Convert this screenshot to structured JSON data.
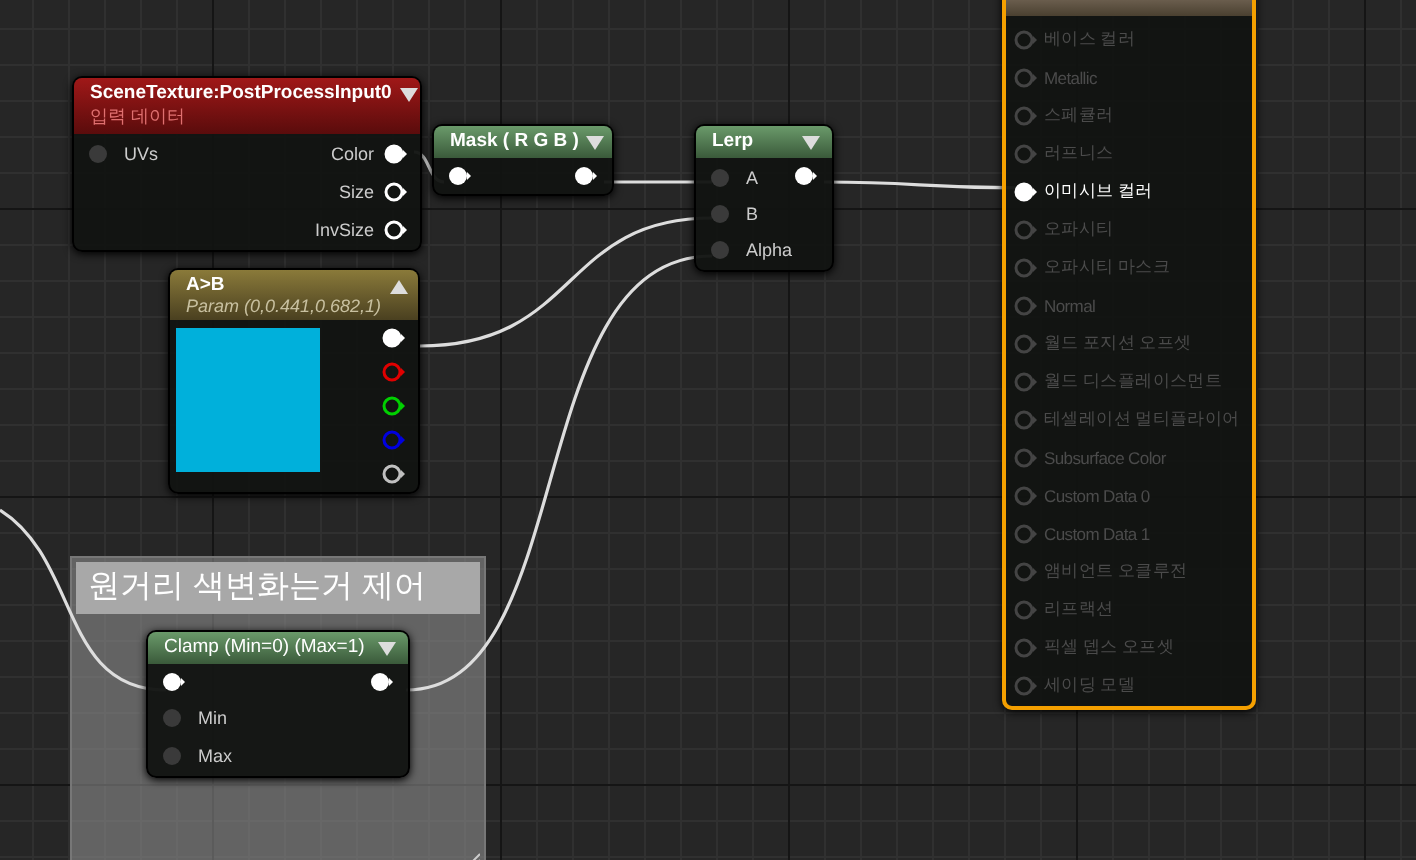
{
  "comment": {
    "title": "원거리 색변화는거 제어"
  },
  "scene_texture": {
    "title": "SceneTexture:PostProcessInput0",
    "subtitle": "입력 데이터",
    "expanded": true,
    "inputs": [
      {
        "label": "UVs",
        "connected": false
      }
    ],
    "outputs": [
      {
        "label": "Color",
        "connected": true
      },
      {
        "label": "Size",
        "connected": false
      },
      {
        "label": "InvSize",
        "connected": false
      }
    ]
  },
  "mask": {
    "title": "Mask ( R G B )",
    "expanded": true
  },
  "lerp": {
    "title": "Lerp",
    "expanded": true,
    "inputs": [
      {
        "label": "A"
      },
      {
        "label": "B"
      },
      {
        "label": "Alpha"
      }
    ]
  },
  "param": {
    "title": "A>B",
    "subtitle": "Param (0,0.441,0.682,1)",
    "expanded": false,
    "outputs": [
      {
        "color": "#ffffff",
        "connected": true
      },
      {
        "color": "#e00000",
        "connected": false
      },
      {
        "color": "#00d000",
        "connected": false
      },
      {
        "color": "#0000e0",
        "connected": false
      },
      {
        "color": "#c0c0c0",
        "connected": false
      }
    ]
  },
  "clamp": {
    "title": "Clamp (Min=0) (Max=1)",
    "expanded": true,
    "inputs": [
      {
        "label": "Min",
        "connected": false
      },
      {
        "label": "Max",
        "connected": false
      }
    ]
  },
  "result": {
    "inputs": [
      {
        "label": "베이스 컬러",
        "connected": false
      },
      {
        "label": "Metallic",
        "connected": false
      },
      {
        "label": "스페큘러",
        "connected": false
      },
      {
        "label": "러프니스",
        "connected": false
      },
      {
        "label": "이미시브 컬러",
        "connected": true
      },
      {
        "label": "오파시티",
        "connected": false
      },
      {
        "label": "오파시티 마스크",
        "connected": false
      },
      {
        "label": "Normal",
        "connected": false
      },
      {
        "label": "월드 포지션 오프셋",
        "connected": false
      },
      {
        "label": "월드 디스플레이스먼트",
        "connected": false
      },
      {
        "label": "테셀레이션 멀티플라이어",
        "connected": false
      },
      {
        "label": "Subsurface Color",
        "connected": false
      },
      {
        "label": "Custom Data 0",
        "connected": false
      },
      {
        "label": "Custom Data 1",
        "connected": false
      },
      {
        "label": "앰비언트 오클루전",
        "connected": false
      },
      {
        "label": "리프랙션",
        "connected": false
      },
      {
        "label": "픽셀 뎁스 오프셋",
        "connected": false
      },
      {
        "label": "세이딩 모델",
        "connected": false
      }
    ]
  }
}
